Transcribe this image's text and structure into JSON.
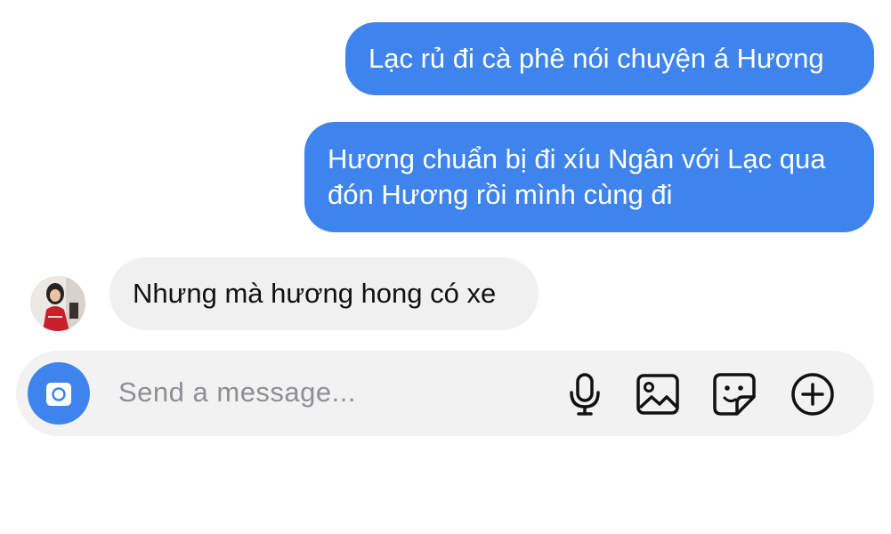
{
  "conversation": {
    "messages": [
      {
        "direction": "outgoing",
        "text": "Lạc rủ đi cà phê nói chuyện á Hương"
      },
      {
        "direction": "outgoing",
        "text": "Hương chuẩn bị đi xíu Ngân với Lạc qua đón Hương rồi mình cùng đi"
      },
      {
        "direction": "incoming",
        "text": "Nhưng mà hương hong có xe",
        "avatar_icon": "contact-avatar-photo"
      }
    ]
  },
  "composer": {
    "placeholder": "Send a message...",
    "camera_icon": "camera-icon",
    "tools": [
      "microphone-icon",
      "image-icon",
      "sticker-icon",
      "plus-circle-icon"
    ]
  },
  "colors": {
    "outgoing_bubble": "#3f84ed",
    "incoming_bubble": "#f0f0f0",
    "composer_bg": "#f2f2f2",
    "placeholder_text": "#8e8e93"
  }
}
